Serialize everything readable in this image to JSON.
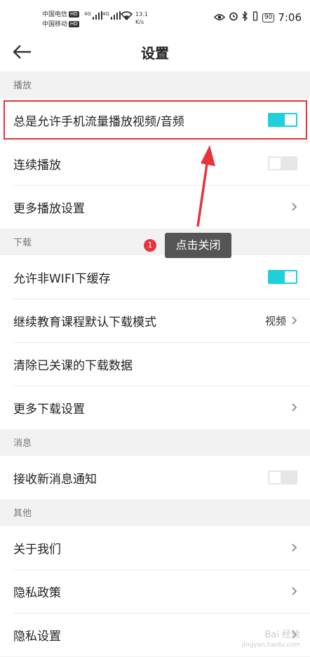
{
  "status_bar": {
    "carrier_1": "中国电信",
    "carrier_2": "中国移动",
    "hd_badge": "HD",
    "signal_1": "4G",
    "signal_2": "4G",
    "net_speed": "13.1",
    "net_speed_unit": "K/s",
    "battery": "90",
    "time": "7:06"
  },
  "app_bar": {
    "title": "设置"
  },
  "sections": [
    {
      "header": "播放",
      "rows": [
        {
          "label": "总是允许手机流量播放视频/音频",
          "control": "toggle",
          "on": true
        },
        {
          "label": "连续播放",
          "control": "toggle",
          "on": false
        },
        {
          "label": "更多播放设置",
          "control": "chevron"
        }
      ]
    },
    {
      "header": "下载",
      "rows": [
        {
          "label": "允许非WIFI下缓存",
          "control": "toggle",
          "on": true
        },
        {
          "label": "继续教育课程默认下载模式",
          "control": "value-chevron",
          "value": "视频"
        },
        {
          "label": "清除已关课的下载数据",
          "control": "none"
        },
        {
          "label": "更多下载设置",
          "control": "chevron"
        }
      ]
    },
    {
      "header": "消息",
      "rows": [
        {
          "label": "接收新消息通知",
          "control": "toggle",
          "on": false
        }
      ]
    },
    {
      "header": "其他",
      "rows": [
        {
          "label": "关于我们",
          "control": "chevron"
        },
        {
          "label": "隐私政策",
          "control": "chevron"
        },
        {
          "label": "隐私设置",
          "control": "chevron"
        }
      ]
    }
  ],
  "annotation": {
    "step_number": "1",
    "tip_text": "点击关闭",
    "highlight_color": "#e8323c"
  },
  "watermark": {
    "text": "Bai 经验",
    "url": "jingyan.baidu.com"
  },
  "colors": {
    "toggle_on": "#1ecfdc",
    "toggle_off": "#e6e6e6",
    "accent_red": "#e8323c"
  }
}
